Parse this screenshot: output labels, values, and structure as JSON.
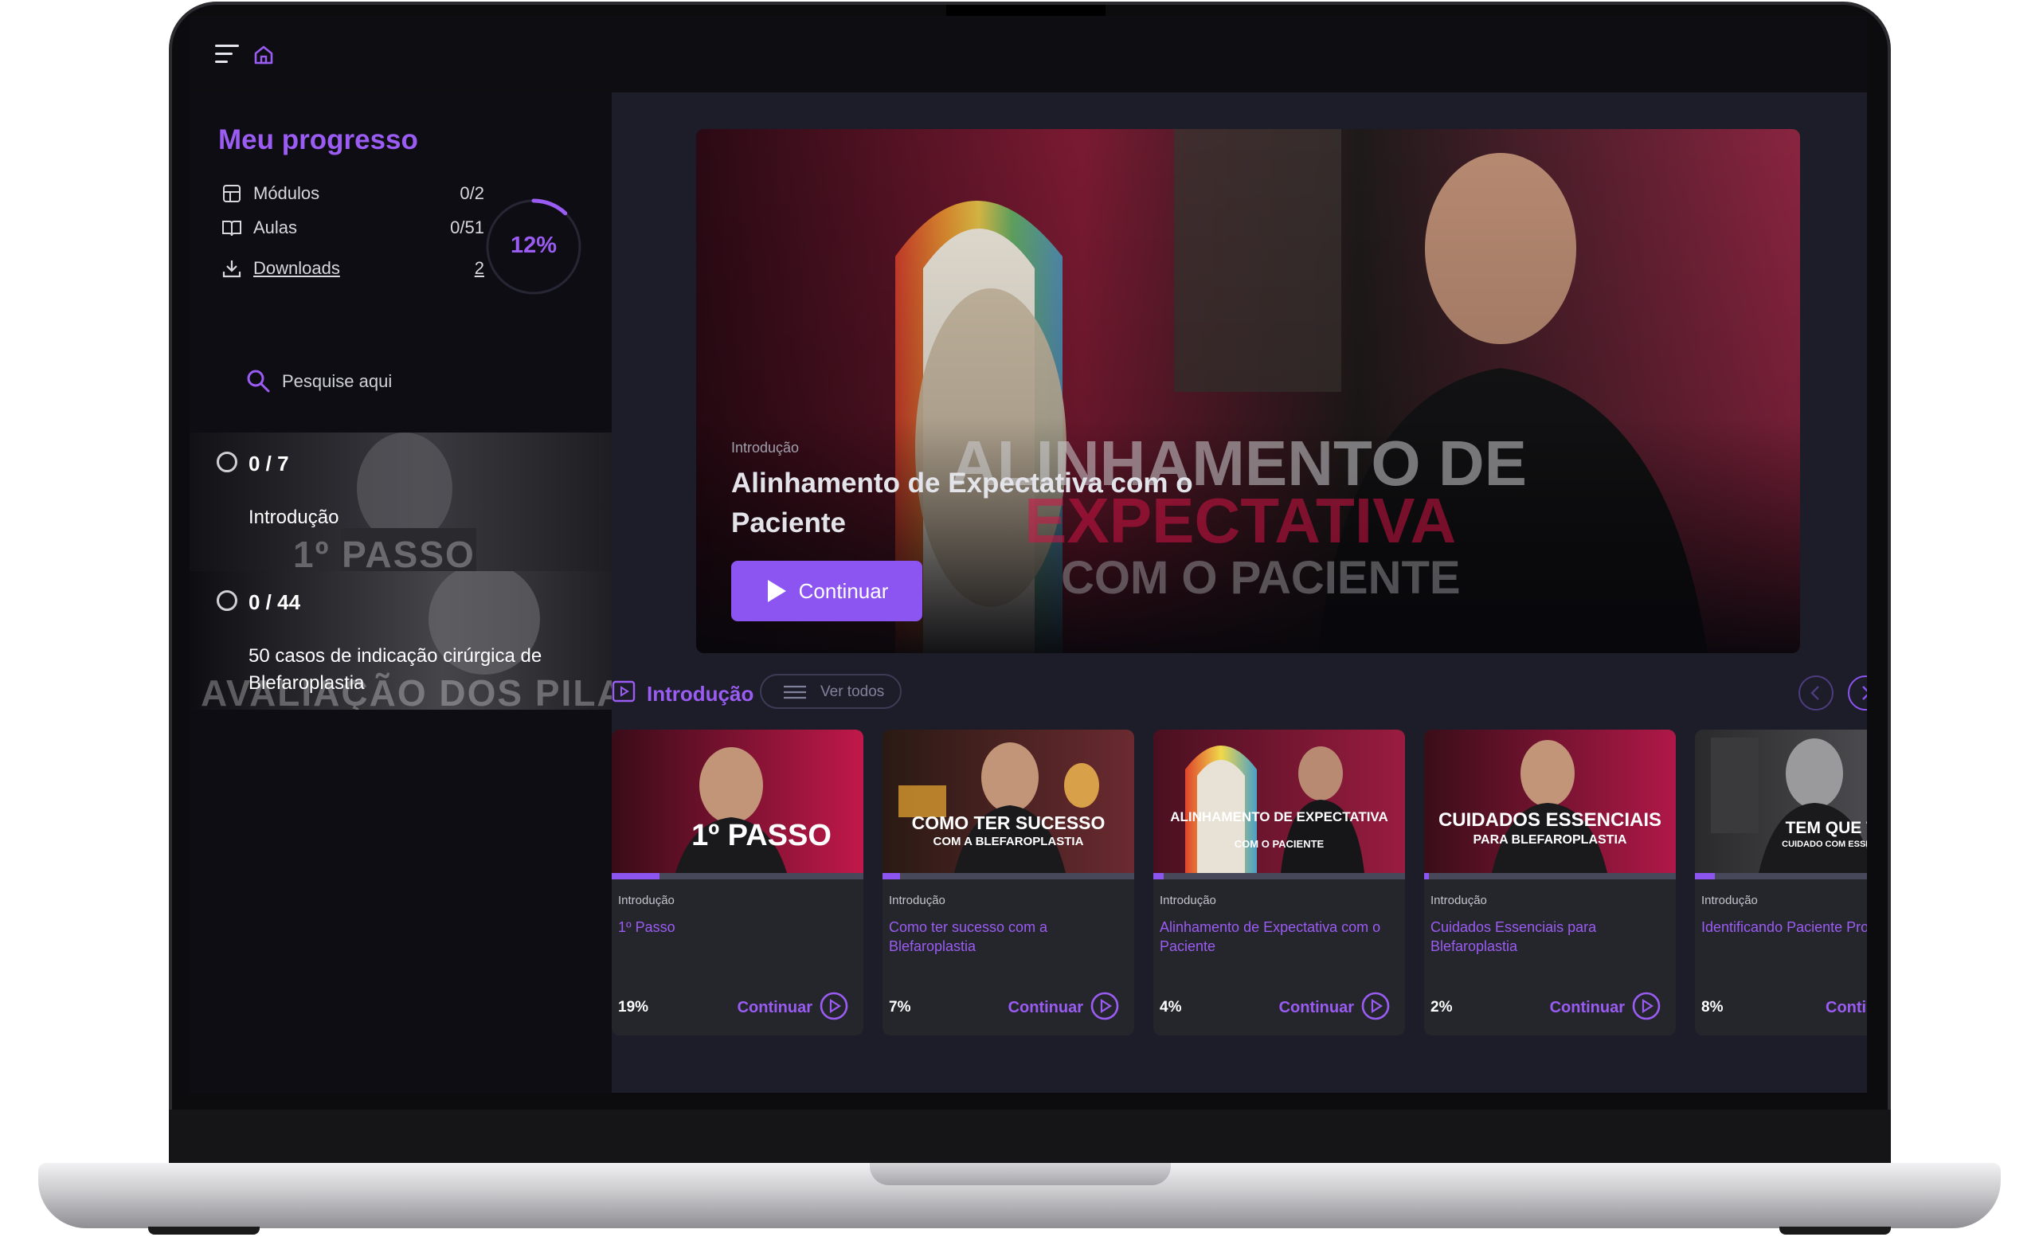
{
  "app": {
    "menu_icon": "hamburger-menu-icon",
    "home_icon": "home-icon",
    "accent": "#8c54f0"
  },
  "sidebar": {
    "title": "Meu progresso",
    "stats": [
      {
        "icon": "modules-icon",
        "label": "Módulos",
        "value": "0/2"
      },
      {
        "icon": "book-icon",
        "label": "Aulas",
        "value": "0/51"
      },
      {
        "icon": "download-icon",
        "label": "Downloads",
        "value": "2"
      }
    ],
    "progress_label": "12%",
    "progress_fraction": 0.12,
    "search_placeholder": "Pesquise aqui",
    "modules": [
      {
        "count": "0 / 7",
        "name": "Introdução",
        "thumb_text": "1º PASSO"
      },
      {
        "count": "0 / 44",
        "name": "50 casos de indicação cirúrgica de Blefaroplastia",
        "thumb_text": "AVALIAÇÃO DOS PILARES"
      }
    ]
  },
  "hero": {
    "subtitle": "Introdução",
    "title": "Alinhamento de Expectativa com o Paciente",
    "button_label": "Continuar",
    "overlay_line1": "ALINHAMENTO DE",
    "overlay_line2": "EXPECTATIVA",
    "overlay_line3": "COM O PACIENTE"
  },
  "row": {
    "title": "Introdução",
    "ver_todos": "Ver todos",
    "cards": [
      {
        "subtitle": "Introdução",
        "title": "1º Passo",
        "percent": "19%",
        "progress": 0.19,
        "cta": "Continuar",
        "thumb_line1": "1º PASSO",
        "thumb_line2": ""
      },
      {
        "subtitle": "Introdução",
        "title": "Como ter sucesso com a Blefaroplastia",
        "percent": "7%",
        "progress": 0.07,
        "cta": "Continuar",
        "thumb_line1": "COMO TER SUCESSO",
        "thumb_line2": "COM A BLEFAROPLASTIA"
      },
      {
        "subtitle": "Introdução",
        "title": "Alinhamento de Expectativa com o Paciente",
        "percent": "4%",
        "progress": 0.04,
        "cta": "Continuar",
        "thumb_line1": "ALINHAMENTO DE EXPECTATIVA",
        "thumb_line2": "COM O PACIENTE"
      },
      {
        "subtitle": "Introdução",
        "title": "Cuidados Essenciais para Blefaroplastia",
        "percent": "2%",
        "progress": 0.02,
        "cta": "Continuar",
        "thumb_line1": "CUIDADOS ESSENCIAIS",
        "thumb_line2": "PARA BLEFAROPLASTIA"
      },
      {
        "subtitle": "Introdução",
        "title": "Identificando Paciente Prob",
        "percent": "8%",
        "progress": 0.08,
        "cta": "Continu",
        "thumb_line1": "TEM QUE TOMAI",
        "thumb_line2": "CUIDADO COM ESSES PACIENTE"
      }
    ]
  }
}
